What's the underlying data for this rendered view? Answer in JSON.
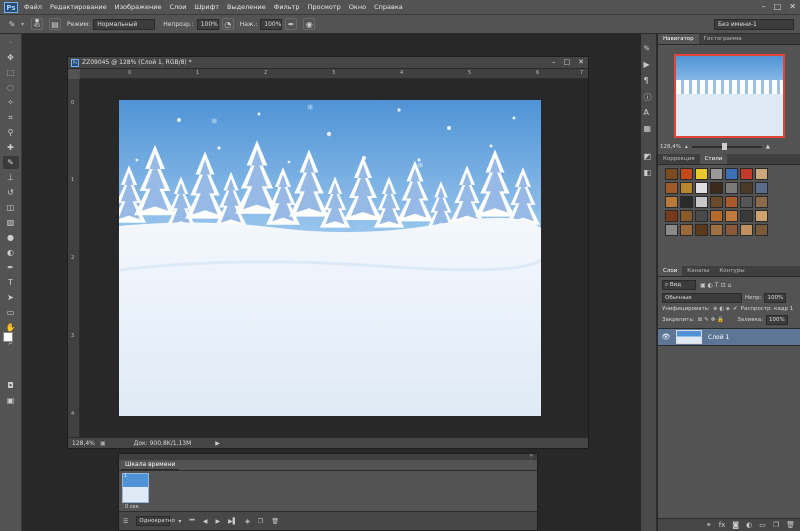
{
  "app": {
    "logo": "Ps"
  },
  "menu": [
    "Файл",
    "Редактирование",
    "Изображение",
    "Слои",
    "Шрифт",
    "Выделение",
    "Фильтр",
    "Просмотр",
    "Окно",
    "Справка"
  ],
  "options": {
    "brush_size": "45",
    "mode_label": "Режим:",
    "mode_value": "Нормальный",
    "opacity_label": "Непрозр.:",
    "opacity_value": "100%",
    "pressure_label": "Наж.:",
    "pressure_value": "100%",
    "workspace_value": "Без имени-1"
  },
  "document": {
    "tab_icon": "Ps",
    "title": "ZZ09045 @ 128% (Слой 1, RGB/8) *",
    "h_ruler_ticks": [
      "0",
      "1",
      "2",
      "3",
      "4",
      "5",
      "6",
      "7"
    ],
    "v_ruler_ticks": [
      "0",
      "1",
      "2",
      "3",
      "4"
    ],
    "zoom": "128,4%",
    "doc_info": "Док: 900,8K/1,13M"
  },
  "timeline": {
    "title": "Шкала времени",
    "frame_label": "0 сек.",
    "frame_number": "1",
    "loop_value": "Однократно"
  },
  "navigator": {
    "tabs": [
      "Навигатор",
      "Гистограмма"
    ],
    "zoom": "128,4%"
  },
  "styles_panel": {
    "tabs": [
      "Коррекция",
      "Стили"
    ],
    "swatch_colors": [
      "#7a4c1e",
      "#c24a1a",
      "#e8c82a",
      "#9a9a9a",
      "#3b6fb8",
      "#c23b2a",
      "#c9a77a",
      "#a05a2a",
      "#b8862e",
      "#e0e0e0",
      "#3a2a1a",
      "#7a7a7a",
      "#4a3a2a",
      "#5a6a8a",
      "#b87a3a",
      "#2a2a2a",
      "#c8c8c8",
      "#6a4a2a",
      "#aa5a2a",
      "#555555",
      "#8a6a4a",
      "#7a3a1a",
      "#8a5a2a",
      "#4a4a4a",
      "#b86a2a",
      "#c07a3a",
      "#3a3a3a",
      "#d0a070",
      "#8a8a8a",
      "#9a6a3a",
      "#5a3a1a",
      "#a07040",
      "#8a5a3a",
      "#c09060",
      "#7a5a3a"
    ]
  },
  "layers_panel": {
    "tabs": [
      "Слои",
      "Каналы",
      "Контуры"
    ],
    "filter_label": "Вид",
    "blend_mode": "Обычные",
    "opacity_label": "Непр:",
    "opacity_value": "100%",
    "unify_label": "Унифицировать:",
    "propagate_label": "Распростр. кадр 1",
    "lock_label": "Закрепить:",
    "fill_label": "Заливка:",
    "fill_value": "100%",
    "layer_name": "Слой 1"
  },
  "colors": {
    "chrome": "#535353",
    "canvas_bg": "#282828",
    "sky": "#5b9bd8",
    "snow": "#eef4fb"
  }
}
